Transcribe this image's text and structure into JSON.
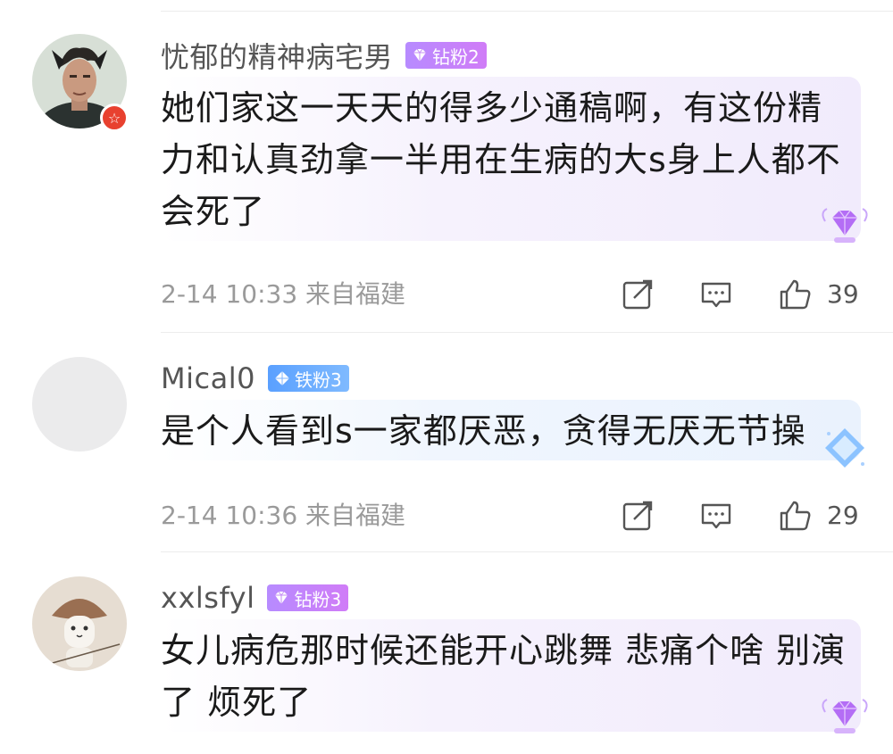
{
  "comments": [
    {
      "username": "忧郁的精神病宅男",
      "badge": "钻粉2",
      "badge_type": "diamond",
      "text": "她们家这一天天的得多少通稿啊，有这份精力和认真劲拿一半用在生病的大s身上人都不会死了",
      "time": "2-14 10:33",
      "location": "来自福建",
      "likes": "39",
      "avatar": "portrait-avatar",
      "verified": true
    },
    {
      "username": "Mical0",
      "badge": "铁粉3",
      "badge_type": "iron",
      "text": "是个人看到s一家都厌恶，贪得无厌无节操",
      "time": "2-14 10:36",
      "location": "来自福建",
      "likes": "29",
      "avatar": "blank-avatar",
      "verified": false
    },
    {
      "username": "xxlsfyl",
      "badge": "钻粉3",
      "badge_type": "diamond",
      "text": "女儿病危那时候还能开心跳舞 悲痛个啥 别演了 烦死了",
      "avatar": "mushroom-cat-avatar",
      "verified": false
    }
  ],
  "colors": {
    "diamond_badge": "#c283f8",
    "iron_badge": "#6aaaff",
    "verified": "#e8412f",
    "meta_text": "#9a9a9a"
  }
}
